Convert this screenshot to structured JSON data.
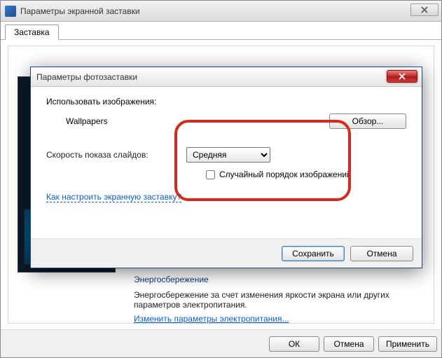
{
  "outer_window": {
    "title": "Параметры экранной заставки",
    "tab_label": "Заставка",
    "buttons": {
      "ok": "ОК",
      "cancel": "Отмена",
      "apply": "Применить"
    }
  },
  "energy": {
    "heading": "Энергосбережение",
    "text": "Энергосбережение за счет изменения яркости экрана или других параметров электропитания.",
    "link": "Изменить параметры электропитания..."
  },
  "modal": {
    "title": "Параметры фотозаставки",
    "use_images_label": "Использовать изображения:",
    "folder_name": "Wallpapers",
    "browse_label": "Обзор...",
    "speed_label": "Скорость показа слайдов:",
    "speed_value": "Средняя",
    "random_label": "Случайный порядок изображений",
    "help_link": "Как настроить экранную заставку?",
    "save": "Сохранить",
    "cancel": "Отмена"
  }
}
